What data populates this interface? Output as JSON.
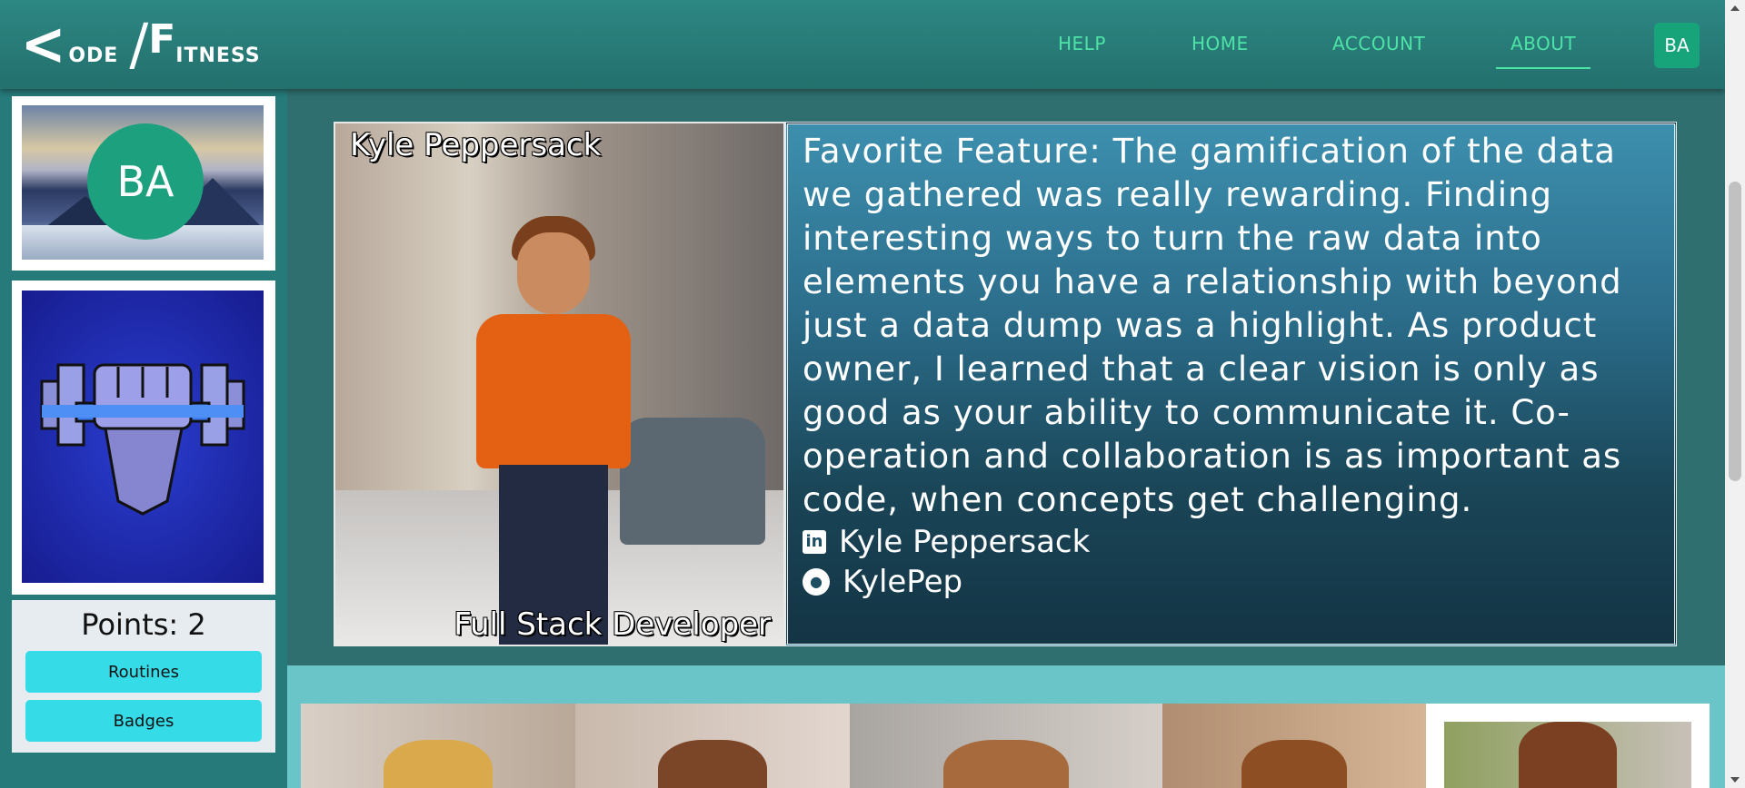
{
  "header": {
    "logo_big": "<",
    "logo_odes": "ODE",
    "logo_slash": "/",
    "logo_f": "F",
    "logo_itness": "ITNESS",
    "logo_alt": "Code Fitness",
    "nav": [
      {
        "label": "HELP"
      },
      {
        "label": "HOME"
      },
      {
        "label": "ACCOUNT"
      },
      {
        "label": "ABOUT",
        "active": true
      }
    ],
    "user_initials": "BA"
  },
  "sidebar": {
    "avatar_initials": "BA",
    "badge_icon": "fist-dumbbell-icon",
    "points_label": "Points: 2",
    "buttons": [
      {
        "label": "Routines"
      },
      {
        "label": "Badges"
      }
    ]
  },
  "profile": {
    "name": "Kyle Peppersack",
    "role": "Full Stack Developer",
    "bio": "Favorite Feature: The gamification of the data we gathered was really rewarding. Finding interesting ways to turn the raw data into elements you have a relationship with beyond just a data dump was a highlight. As product owner, I learned that a clear vision is only as good as your ability to communicate it. Co-operation and collaboration is as important as code, when concepts get challenging.",
    "links": [
      {
        "icon": "linkedin-icon",
        "label": "Kyle Peppersack"
      },
      {
        "icon": "github-icon",
        "label": "KylePep"
      }
    ]
  },
  "colors": {
    "accent_nav": "#4ee3a6",
    "avatar_green": "#1ca07e",
    "button_cyan": "#35dce8",
    "header_teal": "#2d8783"
  }
}
